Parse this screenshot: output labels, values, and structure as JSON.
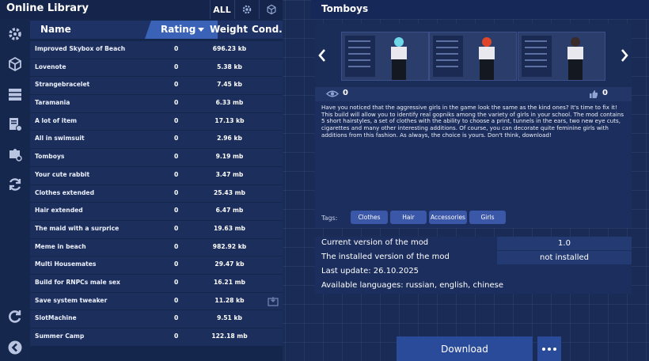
{
  "library": {
    "title": "Online Library",
    "filter_all": "ALL",
    "filter_icons": [
      "gear-icon",
      "cube-icon"
    ],
    "columns": {
      "name": "Name",
      "rating": "Rating",
      "weight": "Weight",
      "condition": "Cond."
    },
    "side_icons": [
      "gear-icon",
      "cube-icon",
      "stack-icon",
      "document-gear-icon",
      "puzzle-gear-icon",
      "refresh-icon",
      "reload-icon",
      "back-icon"
    ],
    "rows": [
      {
        "name": "Improved Skybox of Beach",
        "rating": "0",
        "weight": "696.23 kb"
      },
      {
        "name": "Lovenote",
        "rating": "0",
        "weight": "5.38 kb"
      },
      {
        "name": "Strangebracelet",
        "rating": "0",
        "weight": "7.45 kb"
      },
      {
        "name": "Taramania",
        "rating": "0",
        "weight": "6.33 mb"
      },
      {
        "name": "A lot of item",
        "rating": "0",
        "weight": "17.13 kb"
      },
      {
        "name": "All in swimsuit",
        "rating": "0",
        "weight": "2.96 kb"
      },
      {
        "name": "Tomboys",
        "rating": "0",
        "weight": "9.19 mb"
      },
      {
        "name": "Your cute rabbit",
        "rating": "0",
        "weight": "3.47 mb"
      },
      {
        "name": "Clothes extended",
        "rating": "0",
        "weight": "25.43 mb"
      },
      {
        "name": "Hair extended",
        "rating": "0",
        "weight": "6.47 mb"
      },
      {
        "name": "The maid with a surprice",
        "rating": "0",
        "weight": "19.63 mb"
      },
      {
        "name": "Meme in beach",
        "rating": "0",
        "weight": "982.92 kb"
      },
      {
        "name": "Multi Housemates",
        "rating": "0",
        "weight": "29.47 kb"
      },
      {
        "name": "Build for RNPCs male sex",
        "rating": "0",
        "weight": "16.21 mb"
      },
      {
        "name": "Save system tweaker",
        "rating": "0",
        "weight": "11.28 kb",
        "condition_icon": "installed-box-icon"
      },
      {
        "name": "SlotMachine",
        "rating": "0",
        "weight": "9.51 kb"
      },
      {
        "name": "Summer Camp",
        "rating": "0",
        "weight": "122.18 mb"
      }
    ]
  },
  "mod": {
    "title": "Tomboys",
    "views": "0",
    "likes": "0",
    "description": "Have you noticed that the aggressive girls in the game look the same as the kind ones? It's time to fix it! This build will allow you to identify real gopniks among the variety of girls in your school. The mod contains 5 short hairstyles, a set of clothes with the ability to choose a print, tunnels in the ears, two new eye cuts, cigarettes and many other interesting additions. Of course, you can decorate quite feminine girls with additions from this fashion. As always, the choice is yours. Don't think, download!",
    "tags_label": "Tags:",
    "tags": [
      "Clothes",
      "Hair",
      "Accessories",
      "Girls"
    ],
    "current_version_label": "Current version of the mod",
    "current_version": "1.0",
    "installed_version_label": "The installed version of the mod",
    "installed_version": "not installed",
    "last_update": "Last update: 26.10.2025",
    "languages": "Available languages: russian, english, chinese",
    "download_label": "Download",
    "hair_colors": [
      "#6fd8e8",
      "#e0452a",
      "#3a2a2a"
    ]
  }
}
